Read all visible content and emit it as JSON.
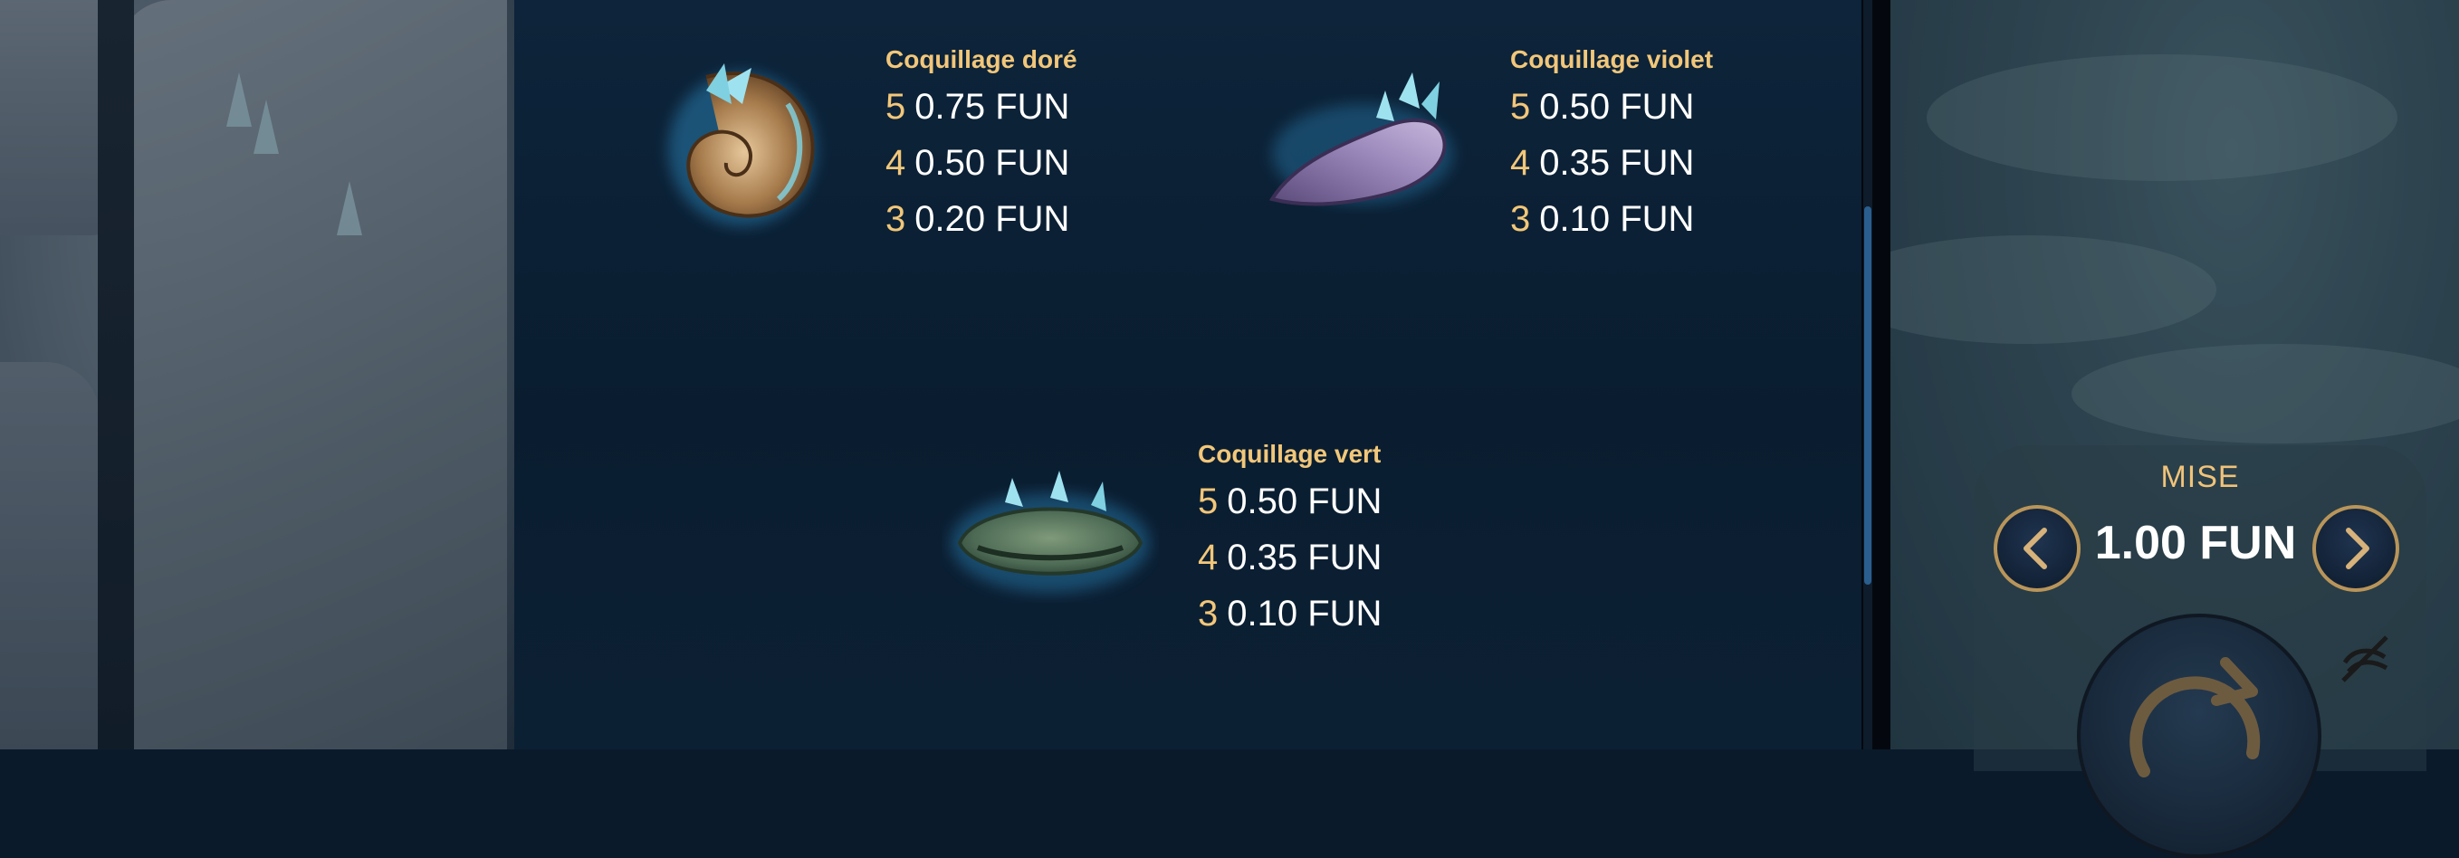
{
  "paytable": {
    "symbols": [
      {
        "name": "Coquillage doré",
        "payouts": [
          {
            "count": "5",
            "value": "0.75 FUN"
          },
          {
            "count": "4",
            "value": "0.50 FUN"
          },
          {
            "count": "3",
            "value": "0.20 FUN"
          }
        ]
      },
      {
        "name": "Coquillage violet",
        "payouts": [
          {
            "count": "5",
            "value": "0.50 FUN"
          },
          {
            "count": "4",
            "value": "0.35 FUN"
          },
          {
            "count": "3",
            "value": "0.10 FUN"
          }
        ]
      },
      {
        "name": "Coquillage vert",
        "payouts": [
          {
            "count": "5",
            "value": "0.50 FUN"
          },
          {
            "count": "4",
            "value": "0.35 FUN"
          },
          {
            "count": "3",
            "value": "0.10 FUN"
          }
        ]
      }
    ]
  },
  "bet": {
    "label": "MISE",
    "value": "1.00 FUN"
  },
  "icons": {
    "prev": "chevron-left-icon",
    "next": "chevron-right-icon",
    "spin": "spin-arrow-icon",
    "autoplay": "autoplay-off-icon"
  },
  "colors": {
    "gold": "#f2c77a",
    "panel": "#0a1d30",
    "button_border": "#b9955a"
  }
}
